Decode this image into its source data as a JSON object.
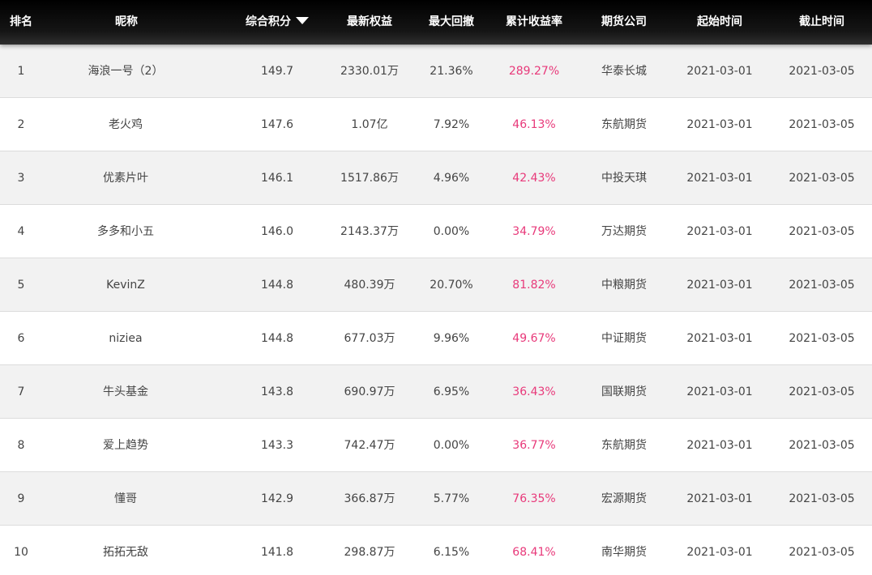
{
  "columns": {
    "rank": "排名",
    "nickname": "昵称",
    "score": "综合积分",
    "equity": "最新权益",
    "drawdown": "最大回撤",
    "return_rate": "累计收益率",
    "company": "期货公司",
    "start": "起始时间",
    "end": "截止时间"
  },
  "sort": {
    "column": "score",
    "direction": "desc",
    "icon": "sort-down-icon"
  },
  "colors": {
    "header_bg": "#000000",
    "row_alt": "#f2f2f2",
    "rate": "#e8397a",
    "text": "#444444"
  },
  "rows": [
    {
      "rank": "1",
      "nickname": "海浪一号（2）",
      "score": "149.7",
      "equity": "2330.01万",
      "drawdown": "21.36%",
      "return_rate": "289.27%",
      "company": "华泰长城",
      "start": "2021-03-01",
      "end": "2021-03-05"
    },
    {
      "rank": "2",
      "nickname": "老火鸡",
      "score": "147.6",
      "equity": "1.07亿",
      "drawdown": "7.92%",
      "return_rate": "46.13%",
      "company": "东航期货",
      "start": "2021-03-01",
      "end": "2021-03-05"
    },
    {
      "rank": "3",
      "nickname": "优素片叶",
      "score": "146.1",
      "equity": "1517.86万",
      "drawdown": "4.96%",
      "return_rate": "42.43%",
      "company": "中投天琪",
      "start": "2021-03-01",
      "end": "2021-03-05"
    },
    {
      "rank": "4",
      "nickname": "多多和小五",
      "score": "146.0",
      "equity": "2143.37万",
      "drawdown": "0.00%",
      "return_rate": "34.79%",
      "company": "万达期货",
      "start": "2021-03-01",
      "end": "2021-03-05"
    },
    {
      "rank": "5",
      "nickname": "KevinZ",
      "score": "144.8",
      "equity": "480.39万",
      "drawdown": "20.70%",
      "return_rate": "81.82%",
      "company": "中粮期货",
      "start": "2021-03-01",
      "end": "2021-03-05"
    },
    {
      "rank": "6",
      "nickname": "niziea",
      "score": "144.8",
      "equity": "677.03万",
      "drawdown": "9.96%",
      "return_rate": "49.67%",
      "company": "中证期货",
      "start": "2021-03-01",
      "end": "2021-03-05"
    },
    {
      "rank": "7",
      "nickname": "牛头基金",
      "score": "143.8",
      "equity": "690.97万",
      "drawdown": "6.95%",
      "return_rate": "36.43%",
      "company": "国联期货",
      "start": "2021-03-01",
      "end": "2021-03-05"
    },
    {
      "rank": "8",
      "nickname": "爱上趋势",
      "score": "143.3",
      "equity": "742.47万",
      "drawdown": "0.00%",
      "return_rate": "36.77%",
      "company": "东航期货",
      "start": "2021-03-01",
      "end": "2021-03-05"
    },
    {
      "rank": "9",
      "nickname": "懂哥",
      "score": "142.9",
      "equity": "366.87万",
      "drawdown": "5.77%",
      "return_rate": "76.35%",
      "company": "宏源期货",
      "start": "2021-03-01",
      "end": "2021-03-05"
    },
    {
      "rank": "10",
      "nickname": "拓拓无敌",
      "score": "141.8",
      "equity": "298.87万",
      "drawdown": "6.15%",
      "return_rate": "68.41%",
      "company": "南华期货",
      "start": "2021-03-01",
      "end": "2021-03-05"
    }
  ]
}
